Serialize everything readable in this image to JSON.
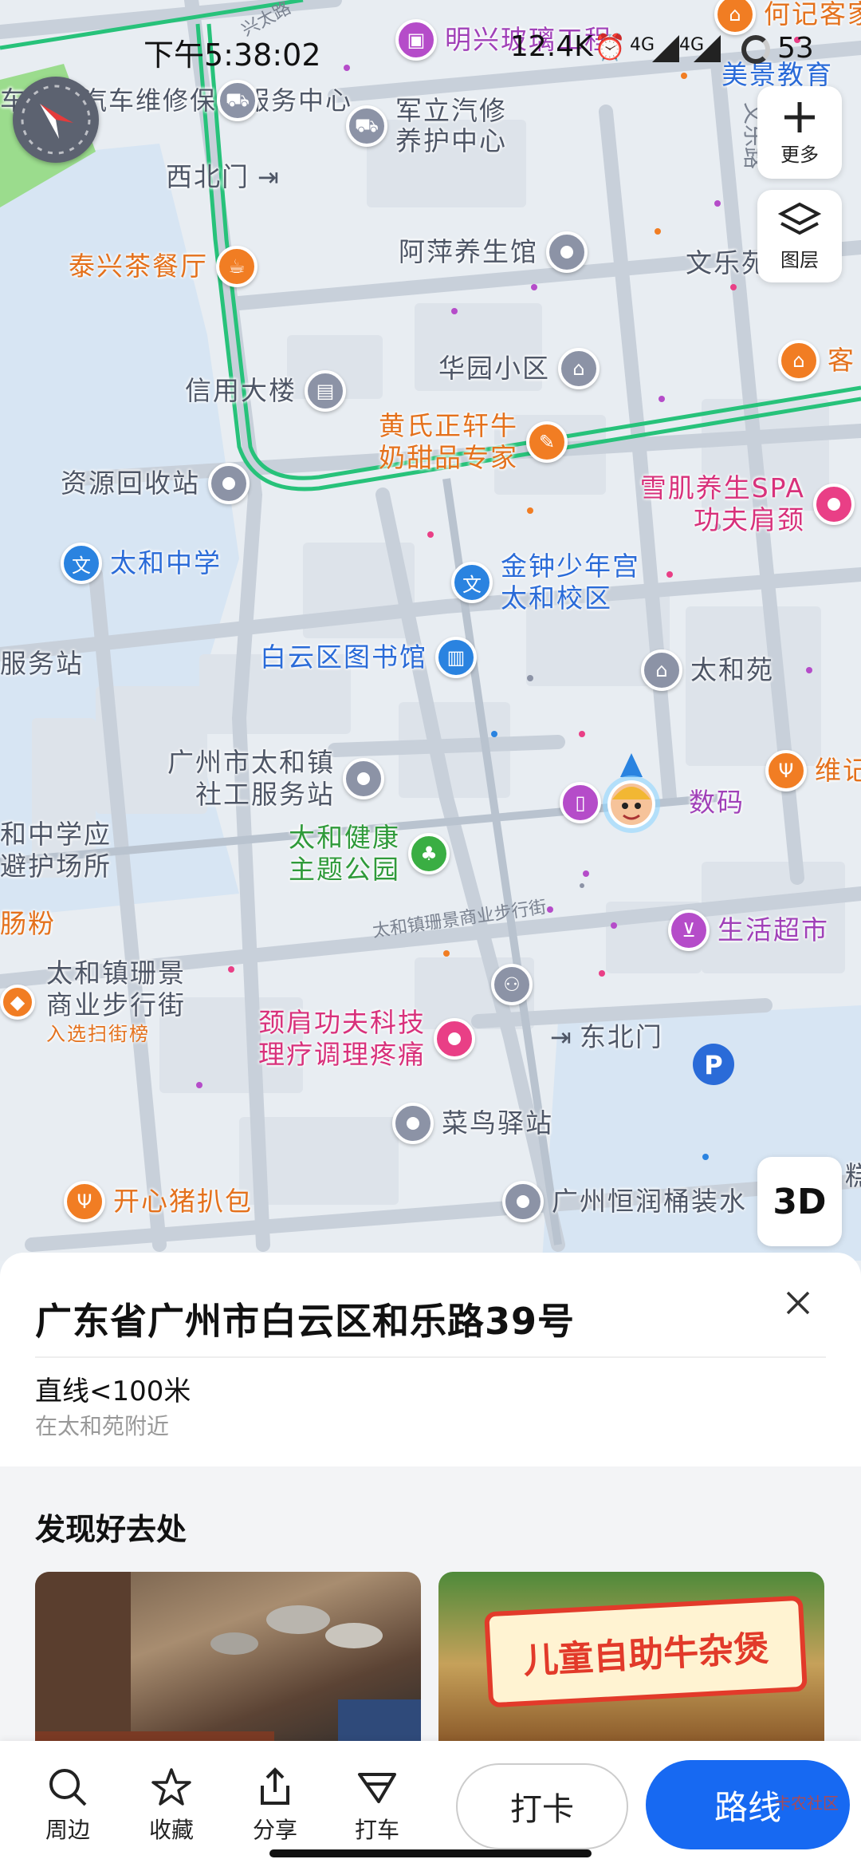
{
  "status_bar": {
    "time": "下午5:38:02",
    "net_speed": "12.4K",
    "sig1": "4G",
    "sig2": "4G",
    "battery": "53"
  },
  "controls": {
    "more_label": "更多",
    "layer_label": "图层",
    "three_d_label": "3D"
  },
  "map": {
    "street_labels": [
      "兴太路",
      "文乐路",
      "太和镇珊景商业步行街"
    ],
    "pois": [
      {
        "name": "明兴玻璃工程",
        "color": "purple"
      },
      {
        "name": "何记客家",
        "color": "orange"
      },
      {
        "name": "美景教育",
        "color": "blue"
      },
      {
        "name": "车博士汽车维修保养服务中心",
        "color": "gray"
      },
      {
        "name": "军立汽修养护中心",
        "color": "gray"
      },
      {
        "name": "西北门",
        "color": "gray"
      },
      {
        "name": "阿萍养生馆",
        "color": "gray"
      },
      {
        "name": "文乐苑",
        "color": "gray"
      },
      {
        "name": "泰兴茶餐厅",
        "color": "orange"
      },
      {
        "name": "客",
        "color": "orange"
      },
      {
        "name": "华园小区",
        "color": "gray"
      },
      {
        "name": "信用大楼",
        "color": "gray"
      },
      {
        "name": "黄氏正轩牛奶甜品专家",
        "color": "orange"
      },
      {
        "name": "资源回收站",
        "color": "gray"
      },
      {
        "name": "雪肌养生SPA功夫肩颈",
        "color": "pink"
      },
      {
        "name": "太和中学",
        "color": "blue"
      },
      {
        "name": "金钟少年宫太和校区",
        "color": "blue"
      },
      {
        "name": "服务站",
        "color": "gray"
      },
      {
        "name": "白云区图书馆",
        "color": "blue"
      },
      {
        "name": "太和苑",
        "color": "gray"
      },
      {
        "name": "广州市太和镇社工服务站",
        "color": "gray"
      },
      {
        "name": "数码",
        "color": "purple"
      },
      {
        "name": "维记",
        "color": "orange"
      },
      {
        "name": "和中学应避护场所",
        "color": "gray"
      },
      {
        "name": "太和健康主题公园",
        "color": "green"
      },
      {
        "name": "肠粉",
        "color": "orange"
      },
      {
        "name": "生活超市",
        "color": "purple"
      },
      {
        "name": "太和镇珊景商业步行街",
        "color": "gray"
      },
      {
        "name": "入选扫街榜",
        "color": "orange"
      },
      {
        "name": "颈肩功夫科技理疗调理疼痛",
        "color": "pink"
      },
      {
        "name": "东北门",
        "color": "gray"
      },
      {
        "name": "菜鸟驿站",
        "color": "gray"
      },
      {
        "name": "开心猪扒包",
        "color": "orange"
      },
      {
        "name": "广州恒润桶装水",
        "color": "gray"
      },
      {
        "name": "糕",
        "color": "gray"
      }
    ]
  },
  "sheet": {
    "address": "广东省广州市白云区和乐路39号",
    "distance": "直线<100米",
    "nearby": "在太和苑附近",
    "discover_title": "发现好去处",
    "photo2_banner": "儿童自助牛杂煲"
  },
  "bottom_bar": {
    "nearby": "周边",
    "favorite": "收藏",
    "share": "分享",
    "taxi": "打车",
    "checkin": "打卡",
    "route": "路线",
    "watermark": "卡农社区"
  },
  "colors": {
    "route_line": "#27c27a",
    "primary_button": "#1769f2",
    "poi_gray": "#8c93a6",
    "poi_orange": "#f17d23",
    "poi_pink": "#e93f86",
    "poi_blue": "#2a83e0",
    "poi_green": "#3aae43",
    "poi_purple": "#b54cc9"
  }
}
